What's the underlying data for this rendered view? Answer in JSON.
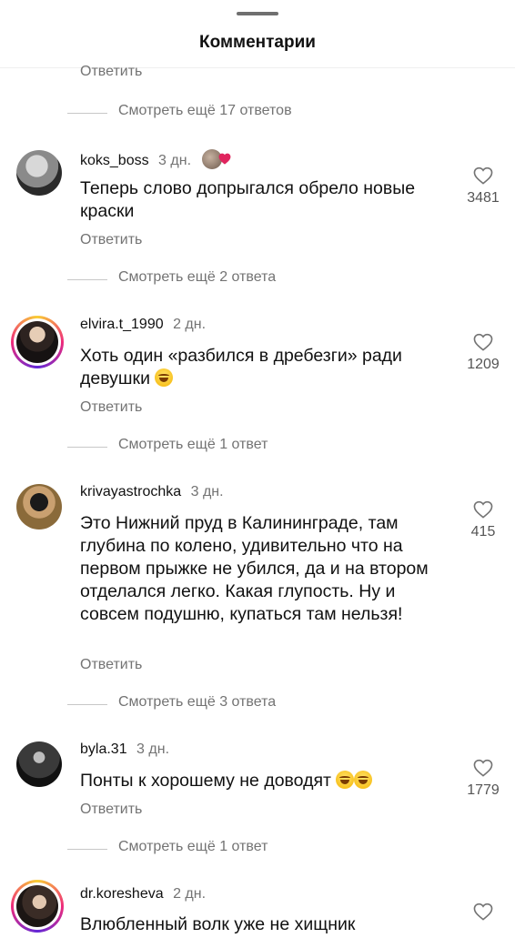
{
  "header": {
    "title": "Комментарии"
  },
  "top_reply_label": "Ответить",
  "top_more_replies": "Смотреть ещё 17 ответов",
  "colors": {
    "secondary_text": "#737373",
    "heart_red": "#e0245e"
  },
  "comments": [
    {
      "username": "koks_boss",
      "time": "3 дн.",
      "text": "Теперь слово допрыгался обрело новые краски",
      "likes": "3481",
      "reply_label": "Ответить",
      "more_replies": "Смотреть ещё 2 ответа",
      "has_author_like": true,
      "story_ring": false
    },
    {
      "username": "elvira.t_1990",
      "time": "2 дн.",
      "text": "Хоть один «разбился в дребезги» ради девушки",
      "emoji": "grinning-sweat",
      "likes": "1209",
      "reply_label": "Ответить",
      "more_replies": "Смотреть ещё 1 ответ",
      "story_ring": true
    },
    {
      "username": "krivayastrochka",
      "time": "3 дн.",
      "text": "Это Нижний пруд в Калининграде, там глубина по колено, удивительно что на первом прыжке не убился, да и на втором отделался легко. Какая глупость. Ну и совсем подушню, купаться там нельзя!",
      "likes": "415",
      "reply_label": "Ответить",
      "more_replies": "Смотреть ещё 3 ответа",
      "story_ring": false
    },
    {
      "username": "byla.31",
      "time": "3 дн.",
      "text": "Понты к хорошему не доводят",
      "emoji": "grinning-sweat-x2",
      "likes": "1779",
      "reply_label": "Ответить",
      "more_replies": "Смотреть ещё 1 ответ",
      "story_ring": false
    },
    {
      "username": "dr.koresheva",
      "time": "2 дн.",
      "text": "Влюбленный волк уже не хищник",
      "story_ring": true
    }
  ]
}
